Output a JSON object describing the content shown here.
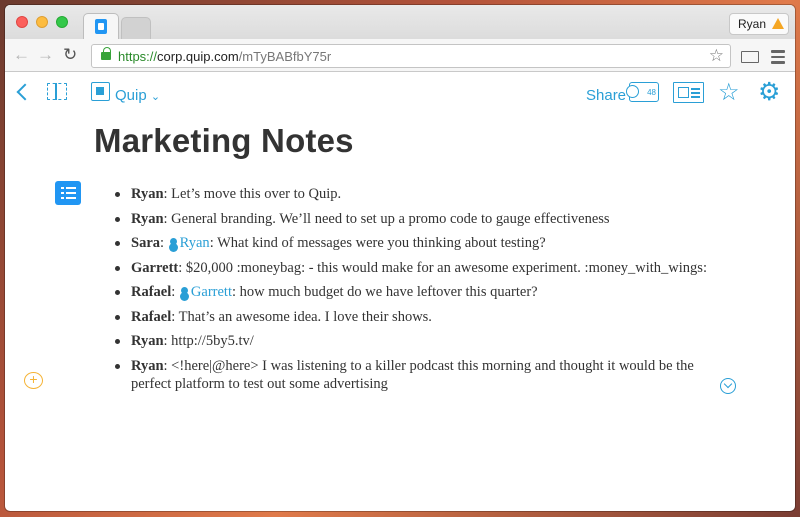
{
  "browser": {
    "profile_name": "Ryan",
    "url": {
      "scheme": "https://",
      "host": "corp.quip.com",
      "path": "/mTyBABfbY75r"
    }
  },
  "toolbar": {
    "workspace_label": "Quip",
    "share_label": "Share",
    "share_count": "48"
  },
  "document": {
    "title": "Marketing Notes",
    "messages": [
      {
        "author": "Ryan",
        "text": ": Let’s move this over to Quip."
      },
      {
        "author": "Ryan",
        "text": ": General branding. We’ll need to set up a promo code to gauge effectiveness"
      },
      {
        "author": "Sara",
        "sep": ": ",
        "mention": "Ryan",
        "text": ": What kind of messages were you thinking about testing?"
      },
      {
        "author": "Garrett",
        "text": ": $20,000 :moneybag: - this would make for an awesome experiment. :money_with_wings:"
      },
      {
        "author": "Rafael",
        "sep": ": ",
        "mention": "Garrett",
        "text": ": how much budget do we have leftover this quarter?"
      },
      {
        "author": "Rafael",
        "text": ": That’s an awesome idea. I love their shows."
      },
      {
        "author": "Ryan",
        "text": ": http://5by5.tv/"
      },
      {
        "author": "Ryan",
        "text": ": <!here|@here> I was listening to a killer podcast this morning and thought it would be the perfect platform to test out some advertising"
      }
    ]
  },
  "colors": {
    "accent": "#2a9fd6",
    "comment_accent": "#f5b335",
    "list_icon_bg": "#2196f3"
  }
}
